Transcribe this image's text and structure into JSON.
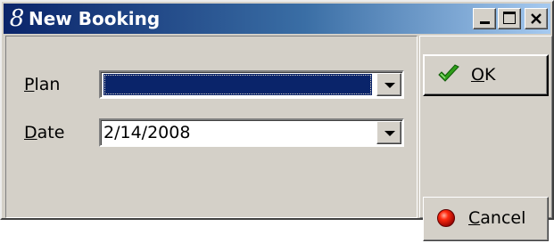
{
  "window": {
    "title": "New Booking",
    "app_icon_glyph": "8",
    "controls": [
      "minimize-icon",
      "maximize-icon",
      "close-icon"
    ]
  },
  "form": {
    "plan": {
      "label_access_key": "P",
      "label_rest": "lan",
      "value": ""
    },
    "date": {
      "label_access_key": "D",
      "label_rest": "ate",
      "value": "2/14/2008"
    }
  },
  "buttons": {
    "ok": {
      "access_key": "O",
      "rest": "K",
      "icon": "checkmark-icon"
    },
    "cancel": {
      "access_key": "C",
      "rest": "ancel",
      "icon": "red-circle-icon"
    }
  },
  "colors": {
    "titlebar_start": "#0a246a",
    "titlebar_end": "#a6caf0",
    "face": "#d4d0c8",
    "selection": "#0a246a",
    "ok_check": "#2f9e1a",
    "cancel_red": "#e00000"
  }
}
